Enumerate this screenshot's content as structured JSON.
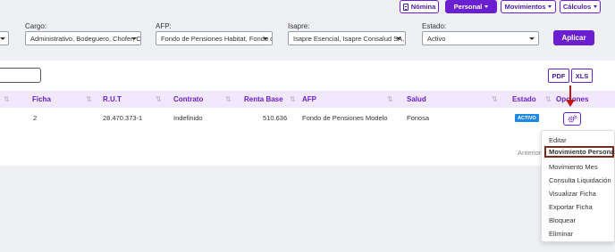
{
  "top_buttons": {
    "nomina": "Nómina",
    "personal": "Personal",
    "movimientos": "Movimientos",
    "calculos": "Cálculos"
  },
  "filters": {
    "cargo": {
      "label": "Cargo:",
      "value": "Administrativo, Bodeguero, Chofer, Co"
    },
    "afp": {
      "label": "AFP:",
      "value": "Fondo de Pensiones Habitat, Fondo de"
    },
    "isapre": {
      "label": "Isapre:",
      "value": "Isapre Esencial, Isapre Consalud SA, I"
    },
    "estado": {
      "label": "Estado:",
      "value": "Activo"
    },
    "apply_label": "Aplicar"
  },
  "export": {
    "pdf": "PDF",
    "xls": "XLS"
  },
  "table": {
    "headers": {
      "ficha": "Ficha",
      "rut": "R.U.T",
      "contrato": "Contrato",
      "renta_base": "Renta Base",
      "afp": "AFP",
      "salud": "Salud",
      "estado": "Estado",
      "opciones": "Opciones"
    },
    "row": {
      "ficha": "2",
      "rut": "28.470.373-1",
      "contrato": "Indefinido",
      "renta_base": "510.636",
      "afp": "Fondo de Pensiones Modelo",
      "salud": "Fonosa",
      "estado": "ACTIVO"
    }
  },
  "pagination": {
    "anterior": "Anterior"
  },
  "options_menu": {
    "items": [
      "Editar",
      "Movimiento Personal",
      "Movimiento Mes",
      "Consulta Liquidación",
      "Visualizar Ficha",
      "Exportar Ficha",
      "Bloquear",
      "Eliminar"
    ],
    "highlighted": "Movimiento Personal"
  },
  "colors": {
    "accent": "#6a1fd0",
    "header_bg": "#f1e9fb",
    "badge": "#1e88e5",
    "annotation": "#c01616",
    "highlight_border": "#7a2c1c"
  },
  "icons": {
    "nomina": "document-icon",
    "options": "gears-icon",
    "sort": "sort-arrows-icon"
  }
}
